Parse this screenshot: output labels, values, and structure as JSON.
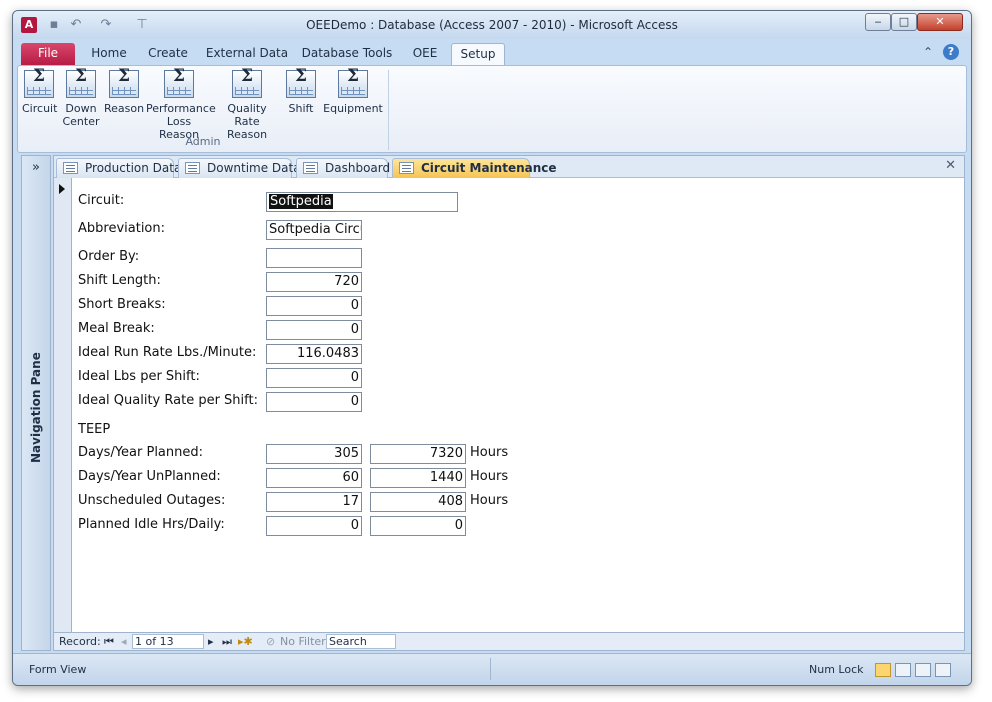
{
  "window": {
    "title": "OEEDemo : Database (Access 2007 - 2010)  -  Microsoft Access",
    "app_icon": "A",
    "controls": {
      "minimize": "‒",
      "maximize": "□",
      "close": "✕"
    }
  },
  "quick_access": {
    "save_icon": "▪",
    "undo_icon": "↶",
    "redo_icon": "↷",
    "customize_icon": "⊤"
  },
  "ribbon": {
    "tabs": [
      {
        "label": "File"
      },
      {
        "label": "Home"
      },
      {
        "label": "Create"
      },
      {
        "label": "External Data"
      },
      {
        "label": "Database Tools"
      },
      {
        "label": "OEE"
      },
      {
        "label": "Setup"
      }
    ],
    "active_tab": "Setup",
    "help_collapse": "⌃",
    "help": "?",
    "group_label": "Admin",
    "buttons": [
      {
        "line1": "Circuit",
        "line2": ""
      },
      {
        "line1": "Down",
        "line2": "Center"
      },
      {
        "line1": "Reason",
        "line2": ""
      },
      {
        "line1": "Performance",
        "line2": "Loss Reason"
      },
      {
        "line1": "Quality Rate",
        "line2": "Reason"
      },
      {
        "line1": "Shift",
        "line2": ""
      },
      {
        "line1": "Equipment",
        "line2": ""
      }
    ],
    "button_icon": "Σ"
  },
  "nav_pane": {
    "label": "Navigation Pane",
    "expand": "»"
  },
  "doc_tabs": [
    {
      "label": "Production Data",
      "active": false
    },
    {
      "label": "Downtime Data",
      "active": false
    },
    {
      "label": "Dashboard",
      "active": false
    },
    {
      "label": "Circuit Maintenance",
      "active": true
    }
  ],
  "close_doc": "✕",
  "form": {
    "circuit": {
      "label": "Circuit:",
      "value": "Softpedia"
    },
    "abbreviation": {
      "label": "Abbreviation:",
      "value": "Softpedia Circu"
    },
    "order_by": {
      "label": "Order By:",
      "value": ""
    },
    "shift_length": {
      "label": "Shift Length:",
      "value": "720"
    },
    "short_breaks": {
      "label": "Short Breaks:",
      "value": "0"
    },
    "meal_break": {
      "label": "Meal Break:",
      "value": "0"
    },
    "ideal_run_rate": {
      "label": "Ideal Run Rate Lbs./Minute:",
      "value": "116.0483"
    },
    "ideal_lbs": {
      "label": "Ideal Lbs per Shift:",
      "value": "0"
    },
    "ideal_quality": {
      "label": "Ideal Quality Rate per Shift:",
      "value": "0"
    },
    "teep_heading": "TEEP",
    "teep_rows": [
      {
        "label": "Days/Year Planned:",
        "days": "305",
        "hours": "7320",
        "unit": "Hours"
      },
      {
        "label": "Days/Year UnPlanned:",
        "days": "60",
        "hours": "1440",
        "unit": "Hours"
      },
      {
        "label": "Unscheduled Outages:",
        "days": "17",
        "hours": "408",
        "unit": "Hours"
      },
      {
        "label": "Planned Idle Hrs/Daily:",
        "days": "0",
        "hours": "0",
        "unit": ""
      }
    ]
  },
  "record_nav": {
    "label": "Record:",
    "first": "⏮",
    "prev": "◂",
    "position": "1 of 13",
    "next": "▸",
    "last": "⏭",
    "new": "▸✱",
    "filter_icon": "⊘",
    "filter": "No Filter",
    "search": "Search"
  },
  "status": {
    "left": "Form View",
    "num_lock": "Num Lock",
    "views": [
      "form-view",
      "datasheet-view",
      "layout-view",
      "design-view"
    ]
  },
  "colors": {
    "file_tab": "#c8234f",
    "active_doc_tab": "#f6c455",
    "window_frame": "#c6dcf2"
  }
}
